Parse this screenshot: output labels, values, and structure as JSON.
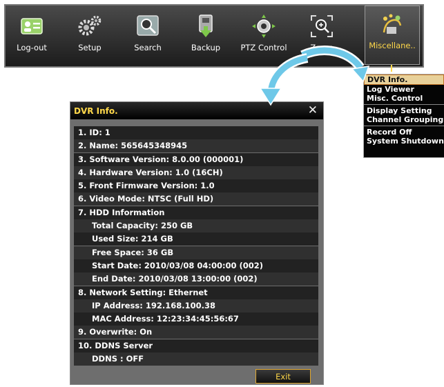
{
  "toolbar": {
    "items": [
      {
        "label": "Log-out",
        "icon": "user-card-icon"
      },
      {
        "label": "Setup",
        "icon": "gears-icon"
      },
      {
        "label": "Search",
        "icon": "magnifier-icon"
      },
      {
        "label": "Backup",
        "icon": "backup-icon"
      },
      {
        "label": "PTZ Control",
        "icon": "ptz-camera-icon"
      },
      {
        "label": "Zoom",
        "icon": "zoom-icon"
      },
      {
        "label": "Miscellane..",
        "icon": "misc-icon"
      }
    ]
  },
  "menu": {
    "items": [
      "DVR Info.",
      "Log Viewer",
      "Misc. Control",
      "Display Setting",
      "Channel Grouping",
      "Record Off",
      "System Shutdown"
    ]
  },
  "dialog": {
    "title": "DVR Info.",
    "rows": [
      "1. ID: 1",
      "2. Name: 565645348945",
      "3. Software Version: 8.0.00 (000001)",
      "4. Hardware Version: 1.0 (16CH)",
      "5. Front Firmware Version: 1.0",
      "6. Video Mode: NTSC (Full HD)",
      "7. HDD Information",
      "Total Capacity: 250 GB",
      "Used Size: 214 GB",
      "Free Space: 36 GB",
      "Start Date: 2010/03/08 04:00:00 (002)",
      "End Date: 2010/03/08 13:00:00 (002)",
      "8. Network Setting: Ethernet",
      "IP Address: 192.168.100.38",
      "MAC Address: 12:23:34:45:56:67",
      "9. Overwrite: On",
      "10. DDNS Server",
      "DDNS : OFF"
    ],
    "exit_label": "Exit"
  },
  "colors": {
    "accent": "#ffd84a",
    "arrow": "#6ec8e8",
    "menu_highlight": "#e8d19a"
  }
}
